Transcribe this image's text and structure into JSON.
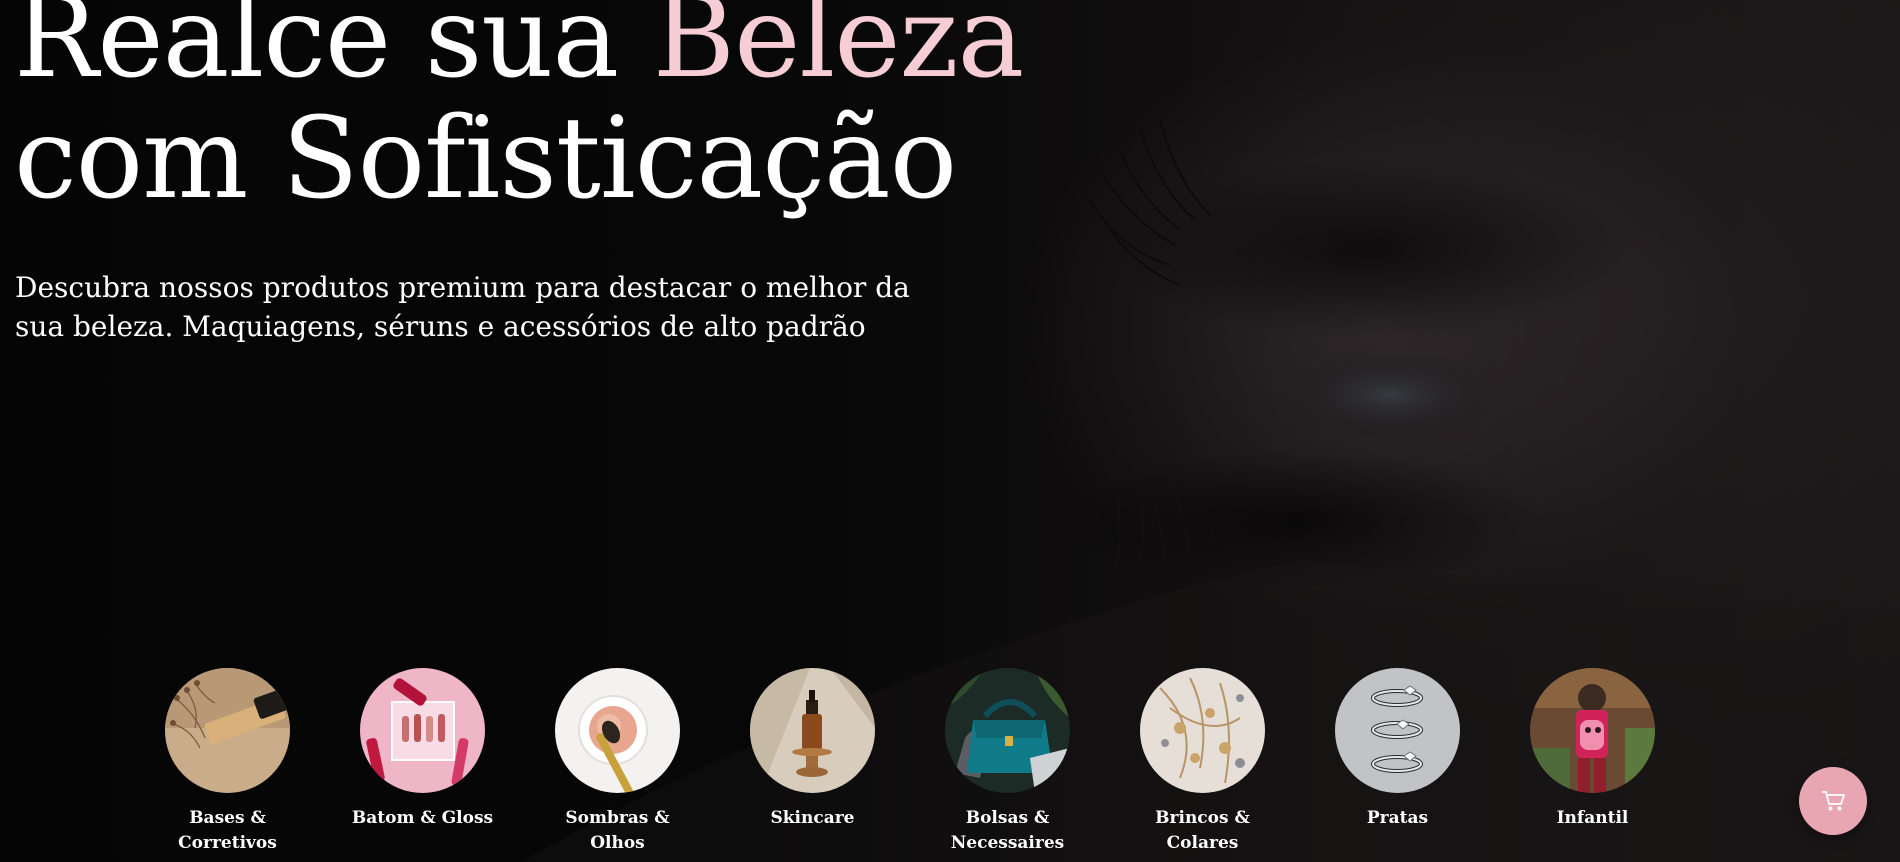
{
  "hero": {
    "headline_part1": "Realce sua ",
    "headline_accent": "Beleza",
    "headline_line2": "com Sofisticação",
    "subtitle": "Descubra nossos produtos premium para destacar o melhor da sua beleza. Maquiagens, séruns e acessórios de alto padrão"
  },
  "categories": [
    {
      "label": "Bases & Corretivos",
      "icon": "foundation-product-image"
    },
    {
      "label": "Batom & Gloss",
      "icon": "lipstick-gloss-image"
    },
    {
      "label": "Sombras & Olhos",
      "icon": "eyeshadow-brush-image"
    },
    {
      "label": "Skincare",
      "icon": "serum-bottle-image"
    },
    {
      "label": "Bolsas & Necessaires",
      "icon": "handbag-image"
    },
    {
      "label": "Brincos & Colares",
      "icon": "jewelry-image"
    },
    {
      "label": "Pratas",
      "icon": "silver-rings-image"
    },
    {
      "label": "Infantil",
      "icon": "kids-backpack-image"
    }
  ],
  "cart": {
    "icon": "cart-icon",
    "glyph": "🛒"
  },
  "colors": {
    "accent_pink": "#f6cdd4",
    "cart_button": "#e8a6b2",
    "background": "#050505",
    "text": "#ffffff"
  }
}
